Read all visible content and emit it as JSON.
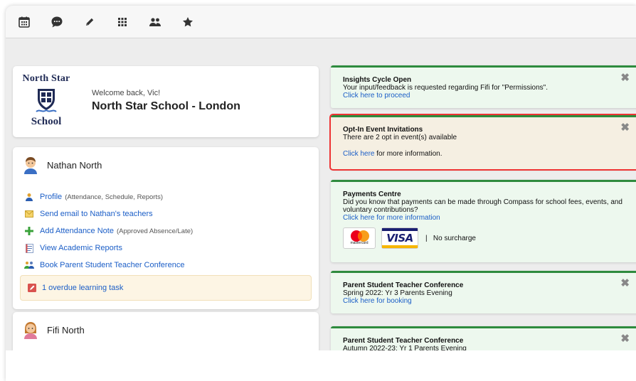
{
  "toolbar": {
    "icons": [
      "calendar-icon",
      "chat-icon",
      "pencil-icon",
      "apps-grid-icon",
      "people-icon",
      "star-icon"
    ]
  },
  "school": {
    "crest_top": "North Star",
    "crest_bottom": "School",
    "welcome": "Welcome back, Vic!",
    "name": "North Star School - London"
  },
  "nathan": {
    "name": "Nathan North",
    "links": [
      {
        "label": "Profile",
        "note": "(Attendance, Schedule, Reports)"
      },
      {
        "label": "Send email to Nathan's teachers",
        "note": ""
      },
      {
        "label": "Add Attendance Note",
        "note": "(Approved Absence/Late)"
      },
      {
        "label": "View Academic Reports",
        "note": ""
      },
      {
        "label": "Book Parent Student Teacher Conference",
        "note": ""
      }
    ],
    "overdue": "1 overdue learning task"
  },
  "fifi": {
    "name": "Fifi North"
  },
  "alerts": {
    "insights": {
      "title": "Insights Cycle Open",
      "text": "Your input/feedback is requested regarding Fifi for \"Permissions\".",
      "link": "Click here to proceed"
    },
    "optin": {
      "title": "Opt-In Event Invitations",
      "text": "There are 2 opt in event(s) available",
      "link": "Click here",
      "after_link": "for more information."
    },
    "payments": {
      "title": "Payments Centre",
      "text": "Did you know that payments can be made through Compass for school fees, events, and voluntary contributions?",
      "link": "Click here for more information",
      "mastercard_label": "mastercard",
      "visa_label": "VISA",
      "surcharge": "|   No surcharge"
    },
    "ptc1": {
      "title": "Parent Student Teacher Conference",
      "text": "Spring 2022: Yr 3 Parents Evening",
      "link": "Click here for booking"
    },
    "ptc2": {
      "title": "Parent Student Teacher Conference",
      "text": "Autumn 2022-23: Yr 1 Parents Evening"
    },
    "close_glyph": "✖"
  },
  "colors": {
    "accent_green": "#2e8b3e",
    "link_blue": "#1b5ec7",
    "highlight_red": "#ee3333"
  }
}
